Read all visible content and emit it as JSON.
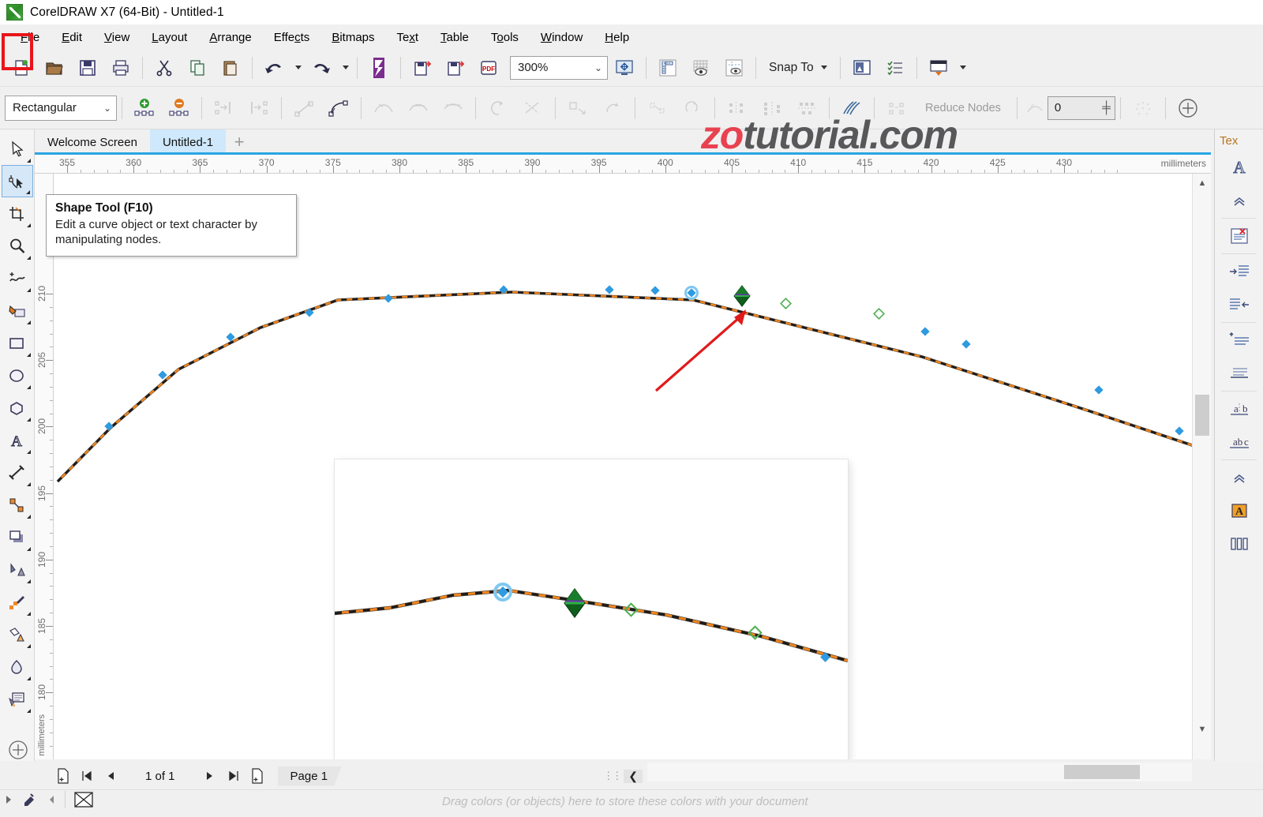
{
  "window": {
    "title": "CorelDRAW X7 (64-Bit) - Untitled-1",
    "logo_icon": "coreldraw-logo-icon"
  },
  "menu": {
    "items": [
      {
        "label": "File",
        "mnemonic": "F"
      },
      {
        "label": "Edit",
        "mnemonic": "E"
      },
      {
        "label": "View",
        "mnemonic": "V"
      },
      {
        "label": "Layout",
        "mnemonic": "L"
      },
      {
        "label": "Arrange",
        "mnemonic": "A"
      },
      {
        "label": "Effects",
        "mnemonic": "c"
      },
      {
        "label": "Bitmaps",
        "mnemonic": "B"
      },
      {
        "label": "Text",
        "mnemonic": "x"
      },
      {
        "label": "Table",
        "mnemonic": "T"
      },
      {
        "label": "Tools",
        "mnemonic": "o"
      },
      {
        "label": "Window",
        "mnemonic": "W"
      },
      {
        "label": "Help",
        "mnemonic": "H"
      }
    ]
  },
  "toolbar": {
    "buttons": [
      {
        "name": "new-document-icon",
        "title": "New"
      },
      {
        "name": "open-document-icon",
        "title": "Open"
      },
      {
        "name": "save-icon",
        "title": "Save"
      },
      {
        "name": "print-icon",
        "title": "Print"
      },
      {
        "name": "cut-icon",
        "title": "Cut"
      },
      {
        "name": "copy-icon",
        "title": "Copy"
      },
      {
        "name": "paste-icon",
        "title": "Paste"
      },
      {
        "name": "undo-icon",
        "title": "Undo"
      },
      {
        "name": "redo-icon",
        "title": "Redo"
      },
      {
        "name": "search-content-icon",
        "title": "Search Content"
      },
      {
        "name": "import-icon",
        "title": "Import"
      },
      {
        "name": "export-icon",
        "title": "Export"
      },
      {
        "name": "publish-pdf-icon",
        "title": "Publish to PDF"
      }
    ],
    "zoom_level": "300%",
    "zoom_levels_icon": "zoom-levels-icon",
    "fullscreen_icon": "fullscreen-preview-icon",
    "ruler_icon": "show-rulers-icon",
    "grid_icon": "show-grid-icon",
    "guides_icon": "show-guidelines-icon",
    "snap_to_label": "Snap To",
    "options_icon": "options-icon",
    "document_options_icon": "document-options-icon",
    "launch_icon": "application-launcher-icon"
  },
  "property_bar": {
    "selection_mode": "Rectangular",
    "buttons": [
      {
        "name": "add-node-icon"
      },
      {
        "name": "delete-node-icon"
      },
      {
        "name": "join-two-nodes-icon"
      },
      {
        "name": "break-curve-icon"
      },
      {
        "name": "convert-to-line-icon"
      },
      {
        "name": "convert-to-curve-icon"
      },
      {
        "name": "cusp-node-icon"
      },
      {
        "name": "smooth-node-icon"
      },
      {
        "name": "symmetrical-node-icon"
      },
      {
        "name": "reverse-direction-icon"
      },
      {
        "name": "extend-curve-to-close-icon"
      },
      {
        "name": "extract-subpath-icon"
      },
      {
        "name": "close-curve-icon"
      },
      {
        "name": "stretch-nodes-icon"
      },
      {
        "name": "rotate-nodes-icon"
      },
      {
        "name": "align-nodes-icon"
      },
      {
        "name": "reflect-nodes-horizontally-icon"
      },
      {
        "name": "reflect-nodes-vertically-icon"
      },
      {
        "name": "elastic-mode-icon"
      },
      {
        "name": "select-all-nodes-icon"
      }
    ],
    "reduce_nodes_label": "Reduce Nodes",
    "curve_smoothness_icon": "curve-smoothness-icon",
    "curve_smoothness_value": "0",
    "spinner_icon": "spinner-icon",
    "select-all-nodes_icon": "select-all-nodes-icon",
    "add_tool_icon": "quick-customize-icon"
  },
  "watermark": {
    "part1": "zo",
    "part2": "tutorial.com",
    "color1": "#e8414f",
    "color2": "#58585a"
  },
  "tabs": {
    "items": [
      {
        "label": "Welcome Screen",
        "active": false
      },
      {
        "label": "Untitled-1",
        "active": true
      }
    ],
    "new_tab_label": "+"
  },
  "rulers": {
    "horizontal": {
      "labels": [
        "355",
        "360",
        "365",
        "370",
        "375",
        "380",
        "385",
        "390",
        "395",
        "400",
        "405",
        "410",
        "415",
        "420",
        "425",
        "430"
      ],
      "unit": "millimeters"
    },
    "vertical": {
      "labels": [
        "210",
        "205",
        "200",
        "195",
        "190",
        "185",
        "180"
      ],
      "unit": "millimeters"
    }
  },
  "toolbox": {
    "tools": [
      {
        "name": "pick-tool",
        "icon": "pick-tool-icon",
        "selected": false
      },
      {
        "name": "shape-tool",
        "icon": "shape-tool-icon",
        "selected": true
      },
      {
        "name": "crop-tool",
        "icon": "crop-tool-icon",
        "selected": false
      },
      {
        "name": "zoom-tool",
        "icon": "zoom-tool-icon",
        "selected": false
      },
      {
        "name": "freehand-tool",
        "icon": "freehand-tool-icon",
        "selected": false
      },
      {
        "name": "smart-fill-tool",
        "icon": "smart-fill-tool-icon",
        "selected": false
      },
      {
        "name": "rectangle-tool",
        "icon": "rectangle-tool-icon",
        "selected": false
      },
      {
        "name": "ellipse-tool",
        "icon": "ellipse-tool-icon",
        "selected": false
      },
      {
        "name": "polygon-tool",
        "icon": "polygon-tool-icon",
        "selected": false
      },
      {
        "name": "text-tool",
        "icon": "text-tool-icon",
        "selected": false
      },
      {
        "name": "parallel-dimension-tool",
        "icon": "dimension-tool-icon",
        "selected": false
      },
      {
        "name": "straight-line-connector-tool",
        "icon": "connector-tool-icon",
        "selected": false
      },
      {
        "name": "drop-shadow-tool",
        "icon": "drop-shadow-tool-icon",
        "selected": false
      },
      {
        "name": "transparency-tool",
        "icon": "transparency-tool-icon",
        "selected": false
      },
      {
        "name": "color-eyedropper-tool",
        "icon": "eyedropper-tool-icon",
        "selected": false
      },
      {
        "name": "interactive-fill-tool",
        "icon": "interactive-fill-tool-icon",
        "selected": false
      },
      {
        "name": "fill-tool",
        "icon": "fill-tool-icon",
        "selected": false
      },
      {
        "name": "outline-tool",
        "icon": "outline-tool-icon",
        "selected": false
      }
    ]
  },
  "tooltip": {
    "title": "Shape Tool (F10)",
    "body": "Edit a curve object or text character by manipulating nodes."
  },
  "docker": {
    "title": "Tex",
    "rows": [
      {
        "name": "text-properties-icon"
      },
      {
        "name": "collapse-chevron-icon"
      },
      {
        "name": "no-text-frame-icon"
      },
      {
        "name": "indent-first-line-icon"
      },
      {
        "name": "indent-right-icon"
      },
      {
        "name": "space-before-paragraph-icon"
      },
      {
        "name": "space-after-paragraph-icon"
      },
      {
        "name": "character-spacing-icon"
      },
      {
        "name": "word-spacing-icon"
      },
      {
        "name": "collapse-chevron-2-icon"
      },
      {
        "name": "character-formatting-icon"
      },
      {
        "name": "column-settings-icon"
      }
    ]
  },
  "page_bar": {
    "add_page_start_icon": "add-page-before-icon",
    "first_page_icon": "first-page-icon",
    "prev_page_icon": "previous-page-icon",
    "page_count_label": "1 of 1",
    "next_page_icon": "next-page-icon",
    "last_page_icon": "last-page-icon",
    "add_page_end_icon": "add-page-after-icon",
    "page_tab_label": "Page 1"
  },
  "status_bar": {
    "palette_hint": "Drag colors (or objects) here to store these colors with your document",
    "collapse_icon": "collapse-left-icon",
    "no-fill_icon": "no-color-swatch-icon"
  },
  "canvas": {
    "curve_stroke_outer": "#2a2a2a",
    "curve_stroke_inner": "#f08a2a",
    "node_unselected_color": "#2f9ae0",
    "node_selected_color": "#0d6b22",
    "control_handle_color": "#5bbf5b",
    "arrow_color": "#e01b1b",
    "selected_node_label": "selected-node",
    "annotation_arrow_label": "annotation-arrow"
  }
}
